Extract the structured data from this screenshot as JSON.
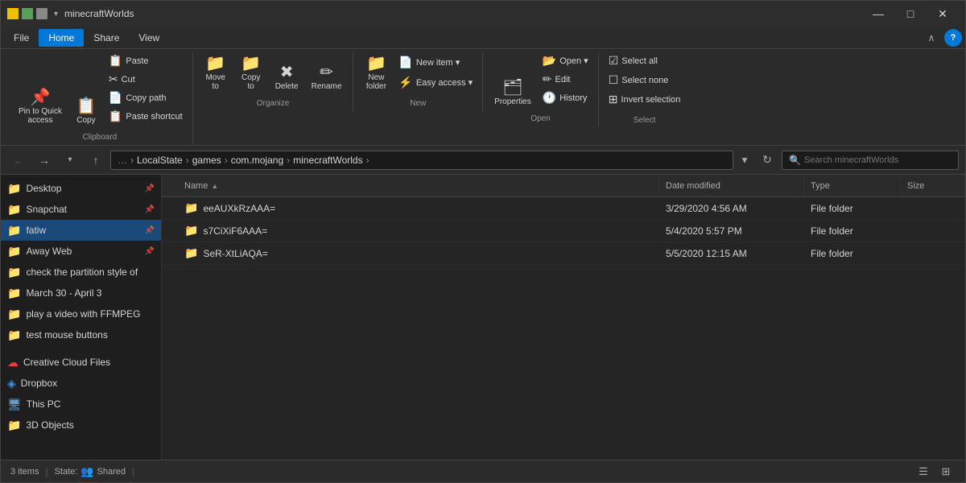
{
  "window": {
    "title": "minecraftWorlds",
    "controls": {
      "minimize": "—",
      "maximize": "□",
      "close": "✕"
    }
  },
  "menu": {
    "items": [
      "File",
      "Home",
      "Share",
      "View"
    ],
    "active_index": 1
  },
  "ribbon": {
    "clipboard_group": {
      "label": "Clipboard",
      "pin_label": "Pin to Quick\naccess",
      "copy_label": "Copy",
      "paste_label": "Paste",
      "cut_label": "Cut",
      "copy_path_label": "Copy path",
      "paste_shortcut_label": "Paste shortcut"
    },
    "organize_group": {
      "label": "Organize",
      "move_to_label": "Move\nto",
      "copy_to_label": "Copy\nto",
      "delete_label": "Delete",
      "rename_label": "Rename"
    },
    "new_group": {
      "label": "New",
      "new_folder_label": "New\nfolder",
      "new_item_label": "New item ▾",
      "easy_access_label": "Easy access ▾"
    },
    "open_group": {
      "label": "Open",
      "properties_label": "Properties",
      "open_label": "Open ▾",
      "edit_label": "Edit",
      "history_label": "History"
    },
    "select_group": {
      "label": "Select",
      "select_all_label": "Select all",
      "select_none_label": "Select none",
      "invert_label": "Invert selection"
    }
  },
  "address_bar": {
    "path_parts": [
      "LocalState",
      "games",
      "com.mojang",
      "minecraftWorlds"
    ],
    "search_placeholder": "Search minecraftWorlds"
  },
  "sidebar": {
    "items": [
      {
        "label": "Desktop",
        "icon": "📁",
        "pinned": true
      },
      {
        "label": "Snapchat",
        "icon": "📁",
        "pinned": true
      },
      {
        "label": "fatiw",
        "icon": "📁",
        "pinned": true,
        "selected": true
      },
      {
        "label": "Away Web",
        "icon": "📁",
        "pinned": true
      },
      {
        "label": "check the partition style of",
        "icon": "📁",
        "pinned": false
      },
      {
        "label": "March 30 - April 3",
        "icon": "📁",
        "pinned": false
      },
      {
        "label": "play a video with FFMPEG",
        "icon": "📁",
        "pinned": false
      },
      {
        "label": "test mouse buttons",
        "icon": "📁",
        "pinned": false
      }
    ],
    "special_items": [
      {
        "label": "Creative Cloud Files",
        "icon": "☁",
        "type": "creative"
      },
      {
        "label": "Dropbox",
        "icon": "◈",
        "type": "dropbox"
      },
      {
        "label": "This PC",
        "icon": "🖥",
        "type": "pc"
      },
      {
        "label": "3D Objects",
        "icon": "📁",
        "type": "folder"
      }
    ]
  },
  "file_list": {
    "columns": [
      "Name",
      "Date modified",
      "Type",
      "Size"
    ],
    "files": [
      {
        "name": "eeAUXkRzAAA=",
        "date": "3/29/2020 4:56 AM",
        "type": "File folder",
        "size": ""
      },
      {
        "name": "s7CiXiF6AAA=",
        "date": "5/4/2020 5:57 PM",
        "type": "File folder",
        "size": ""
      },
      {
        "name": "SeR-XtLiAQA=",
        "date": "5/5/2020 12:15 AM",
        "type": "File folder",
        "size": ""
      }
    ]
  },
  "status_bar": {
    "items_count": "3 items",
    "divider": "|",
    "state_label": "State:",
    "shared_label": "Shared",
    "end_divider": "|"
  }
}
